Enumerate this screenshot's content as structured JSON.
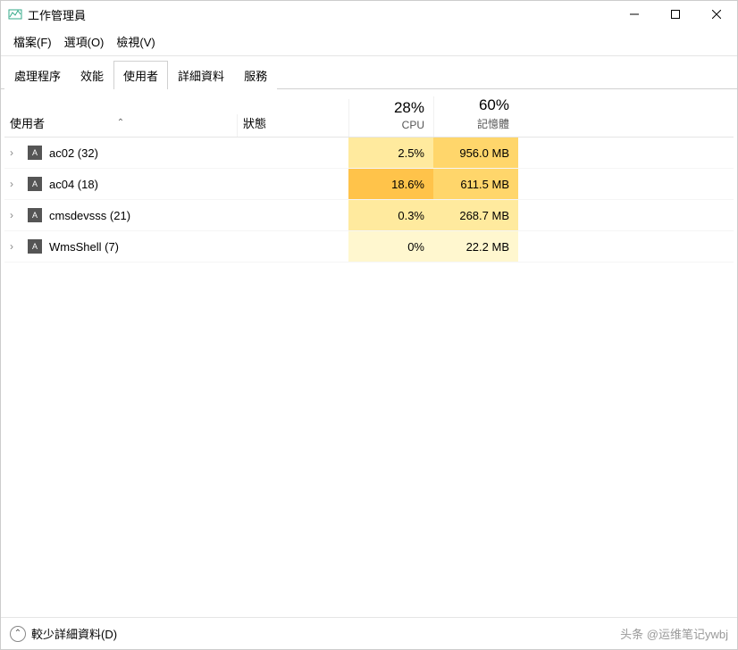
{
  "window": {
    "title": "工作管理員"
  },
  "menu": {
    "file": "檔案(F)",
    "options": "選項(O)",
    "view": "檢視(V)"
  },
  "tabs": {
    "processes": "處理程序",
    "performance": "效能",
    "users": "使用者",
    "details": "詳細資料",
    "services": "服務"
  },
  "headers": {
    "user": "使用者",
    "status": "狀態",
    "cpu_pct": "28%",
    "cpu_label": "CPU",
    "mem_pct": "60%",
    "mem_label": "記憶體",
    "sort_caret": "⌃"
  },
  "rows": [
    {
      "name": "ac02 (32)",
      "status": "",
      "cpu": "2.5%",
      "mem": "956.0 MB",
      "cpu_heat": "heat-2",
      "mem_heat": "heat-3"
    },
    {
      "name": "ac04 (18)",
      "status": "",
      "cpu": "18.6%",
      "mem": "611.5 MB",
      "cpu_heat": "heat-4",
      "mem_heat": "heat-3"
    },
    {
      "name": "cmsdevsss (21)",
      "status": "",
      "cpu": "0.3%",
      "mem": "268.7 MB",
      "cpu_heat": "heat-2",
      "mem_heat": "heat-2"
    },
    {
      "name": "WmsShell (7)",
      "status": "",
      "cpu": "0%",
      "mem": "22.2 MB",
      "cpu_heat": "heat-1",
      "mem_heat": "heat-1"
    }
  ],
  "footer": {
    "fewer_details": "較少詳細資料(D)"
  },
  "watermark": "头条 @运维笔记ywbj",
  "icons": {
    "user_badge": "A"
  }
}
